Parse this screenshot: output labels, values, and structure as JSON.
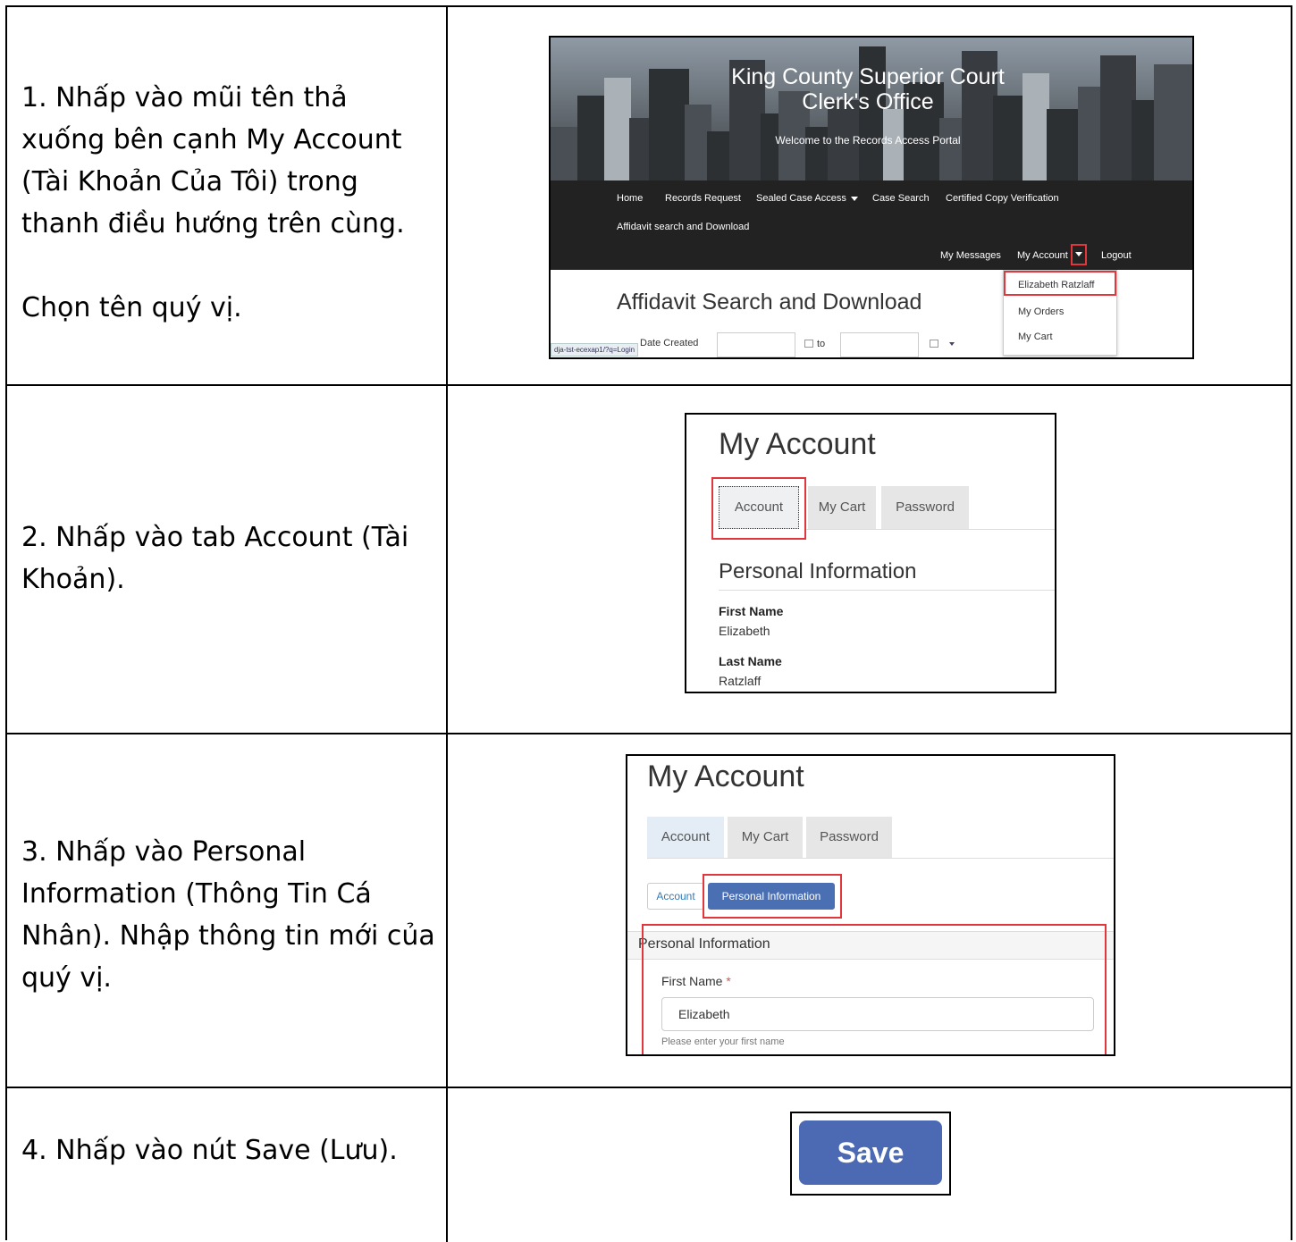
{
  "steps": [
    {
      "lines": [
        "1.   Nhấp vào mũi tên thả xuống bên cạnh My Account (Tài Khoản Của Tôi) trong thanh điều hướng trên cùng."
      ],
      "extra": "Chọn tên quý vị.",
      "screenshot": {
        "title_line1": "King County Superior Court",
        "title_line2": "Clerk's Office",
        "welcome": "Welcome to the Records Access Portal",
        "nav": [
          "Home",
          "Records Request",
          "Sealed Case Access",
          "Case Search",
          "Certified Copy Verification",
          "Affidavit search and Download"
        ],
        "nav_right": [
          "My Messages",
          "My Account",
          "Logout"
        ],
        "dropdown": [
          "Elizabeth Ratzlaff",
          "My Orders",
          "My Cart"
        ],
        "heading": "Affidavit Search and Download",
        "date_label": "Date Created",
        "to_label": "to",
        "status_url": "dja-tst-ecexap1/?q=Login"
      }
    },
    {
      "lines": [
        "2.   Nhấp vào tab Account (Tài Khoản)."
      ],
      "screenshot": {
        "title": "My Account",
        "tabs": [
          "Account",
          "My Cart",
          "Password"
        ],
        "section": "Personal Information",
        "fields": [
          {
            "label": "First Name",
            "value": "Elizabeth"
          },
          {
            "label": "Last Name",
            "value": "Ratzlaff"
          }
        ]
      }
    },
    {
      "lines": [
        "3.   Nhấp vào Personal Information (Thông Tin Cá Nhân). Nhập thông tin mới của quý vị."
      ],
      "screenshot": {
        "title": "My Account",
        "tabs": [
          "Account",
          "My Cart",
          "Password"
        ],
        "subtabs": [
          "Account",
          "Personal Information"
        ],
        "panel_title": "Personal Information",
        "field_label": "First Name",
        "required_mark": "*",
        "field_value": "Elizabeth",
        "help": "Please enter your first name"
      }
    },
    {
      "lines": [
        "4.   Nhấp vào nút Save (Lưu)."
      ],
      "screenshot": {
        "button": "Save"
      }
    }
  ],
  "colors": {
    "highlight": "#e0373d",
    "button": "#4c6ab3",
    "nav_bg": "#222222"
  }
}
